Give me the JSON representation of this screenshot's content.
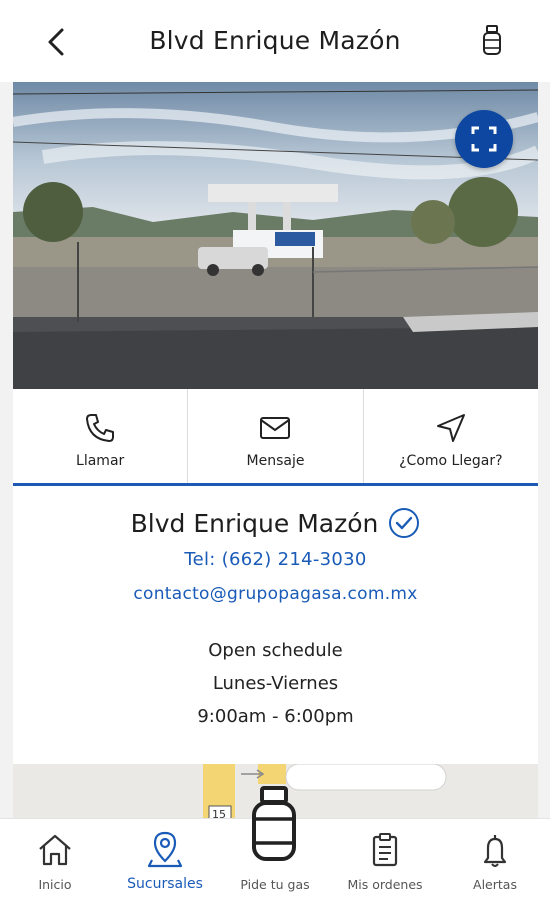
{
  "header": {
    "title": "Blvd Enrique Mazón",
    "back_icon": "chevron-left-icon",
    "gas_icon": "gas-cylinder-icon"
  },
  "photo": {
    "expand_icon": "fullscreen-icon"
  },
  "actions": [
    {
      "label": "Llamar",
      "icon": "phone-icon"
    },
    {
      "label": "Mensaje",
      "icon": "envelope-icon"
    },
    {
      "label": "¿Como Llegar?",
      "icon": "navigation-arrow-icon"
    }
  ],
  "branch": {
    "name": "Blvd Enrique Mazón",
    "verified_icon": "check-circle-icon",
    "tel": "Tel: (662) 214-3030",
    "email": "contacto@grupopagasa.com.mx",
    "schedule_title": "Open schedule",
    "schedule_days": "Lunes-Viernes",
    "schedule_hours": "9:00am - 6:00pm"
  },
  "map": {
    "road_label": "15"
  },
  "bottom_nav": [
    {
      "label": "Inicio",
      "icon": "home-icon"
    },
    {
      "label": "Sucursales",
      "icon": "location-pin-icon",
      "active": true
    },
    {
      "label": "Pide tu gas",
      "icon": "gas-cylinder-icon"
    },
    {
      "label": "Mis ordenes",
      "icon": "clipboard-icon"
    },
    {
      "label": "Alertas",
      "icon": "bell-icon"
    }
  ],
  "colors": {
    "accent": "#1a5bb8",
    "accent_dark": "#0d47a1"
  }
}
